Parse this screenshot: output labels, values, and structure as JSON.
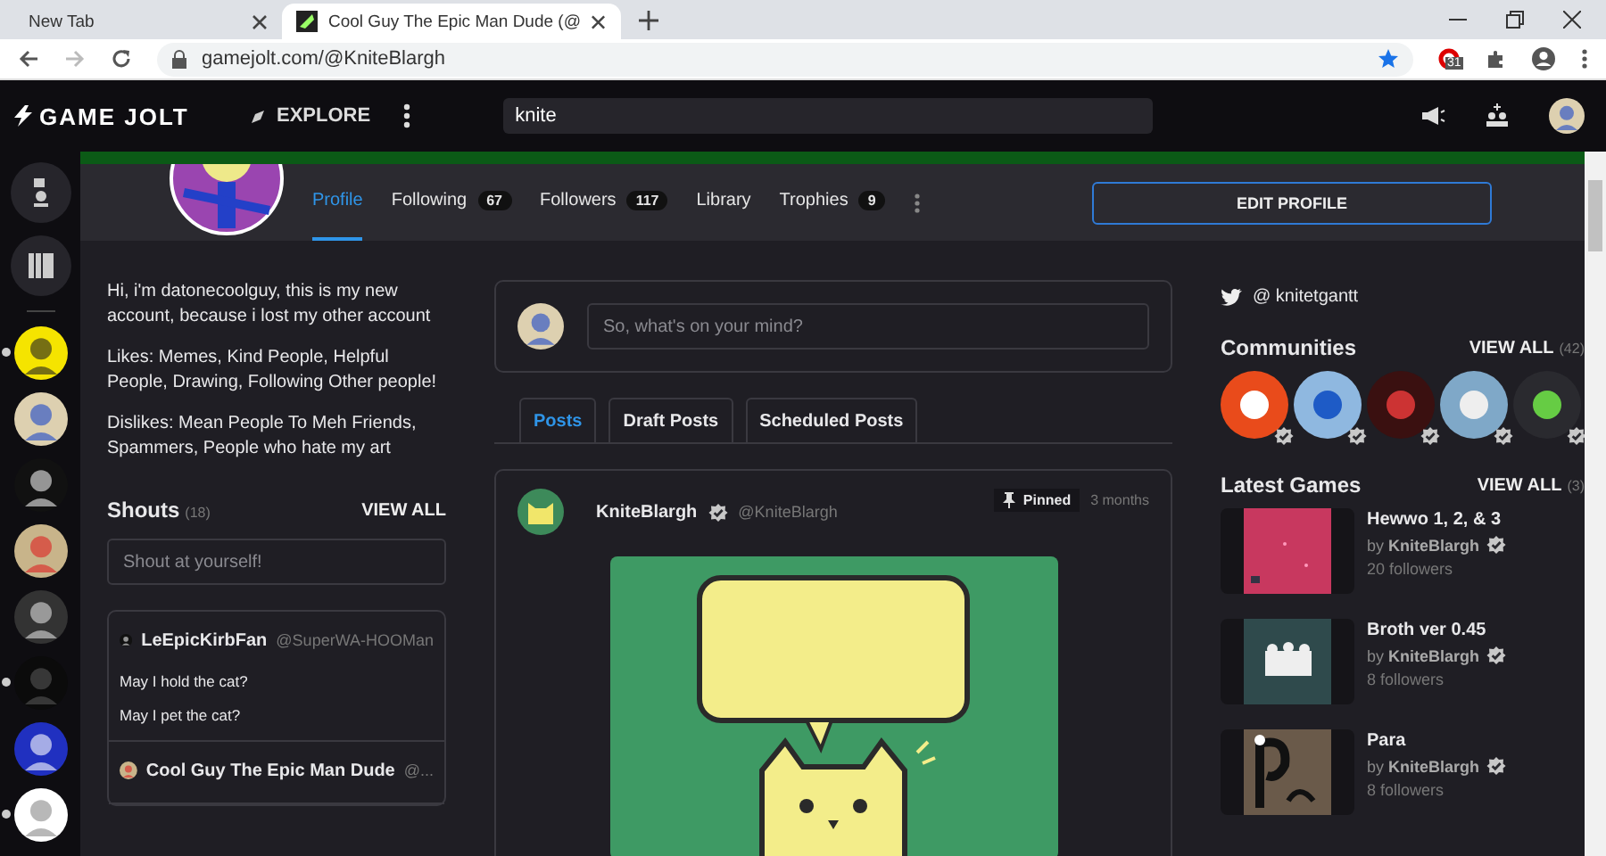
{
  "browser": {
    "tabs": [
      {
        "title": "New Tab",
        "selected": false
      },
      {
        "title": "Cool Guy The Epic Man Dude (@",
        "selected": true
      }
    ],
    "url": "gamejolt.com/@KniteBlargh",
    "extension_badge": "31"
  },
  "topbar": {
    "logo": "GAME JOLT",
    "explore": "EXPLORE",
    "search": {
      "value": "knite"
    }
  },
  "sidebar": {
    "items": [
      {
        "unread": true
      },
      {
        "unread": false
      },
      {
        "unread": false
      },
      {
        "unread": false
      },
      {
        "unread": false
      },
      {
        "unread": true
      },
      {
        "unread": false
      },
      {
        "unread": true
      }
    ]
  },
  "profile_nav": {
    "tabs": [
      {
        "label": "Profile",
        "selected": true
      },
      {
        "label": "Following",
        "count": "67",
        "selected": false
      },
      {
        "label": "Followers",
        "count": "117",
        "selected": false
      },
      {
        "label": "Library",
        "selected": false
      },
      {
        "label": "Trophies",
        "count": "9",
        "selected": false
      }
    ],
    "edit_button": "EDIT PROFILE"
  },
  "bio": [
    "Hi, i'm datonecoolguy, this is my new account, because i lost my other account",
    "Likes: Memes, Kind People, Helpful People, Drawing, Following Other people!",
    "Dislikes: Mean People To Meh Friends, Spammers, People who hate my art"
  ],
  "shouts": {
    "title": "Shouts",
    "count": "(18)",
    "view_all": "VIEW ALL",
    "input": {
      "placeholder": "Shout at yourself!"
    },
    "items": [
      {
        "name": "LeEpicKirbFan",
        "handle": "@SuperWA-HOOMan",
        "lines": [
          "May I hold the cat?",
          "May I pet the cat?"
        ]
      },
      {
        "name": "Cool Guy The Epic Man Dude",
        "handle": "@..."
      }
    ]
  },
  "composer": {
    "placeholder": "So, what's on your mind?"
  },
  "feed_tabs": [
    {
      "label": "Posts",
      "selected": true
    },
    {
      "label": "Draft Posts",
      "selected": false
    },
    {
      "label": "Scheduled Posts",
      "selected": false
    }
  ],
  "post": {
    "name": "KniteBlargh",
    "verified": true,
    "handle": "@KniteBlargh",
    "pinned": "Pinned",
    "time": "3 months"
  },
  "twitter": "@ knitetgantt",
  "communities": {
    "title": "Communities",
    "view_all": "VIEW ALL",
    "count": "(42)",
    "items": [
      {
        "verified": true
      },
      {
        "verified": true
      },
      {
        "verified": true
      },
      {
        "verified": true
      },
      {
        "verified": true
      }
    ]
  },
  "latest_games": {
    "title": "Latest Games",
    "view_all": "VIEW ALL",
    "count": "(3)",
    "items": [
      {
        "title": "Hewwo 1, 2, & 3",
        "author": "by **KniteBlargh**",
        "verified": true,
        "followers": "20 followers"
      },
      {
        "title": "Broth ver 0.45",
        "author": "by **KniteBlargh**",
        "verified": true,
        "followers": "8 followers"
      },
      {
        "title": "Para",
        "author": "by **KniteBlargh**",
        "verified": true,
        "followers": "8 followers"
      }
    ]
  }
}
